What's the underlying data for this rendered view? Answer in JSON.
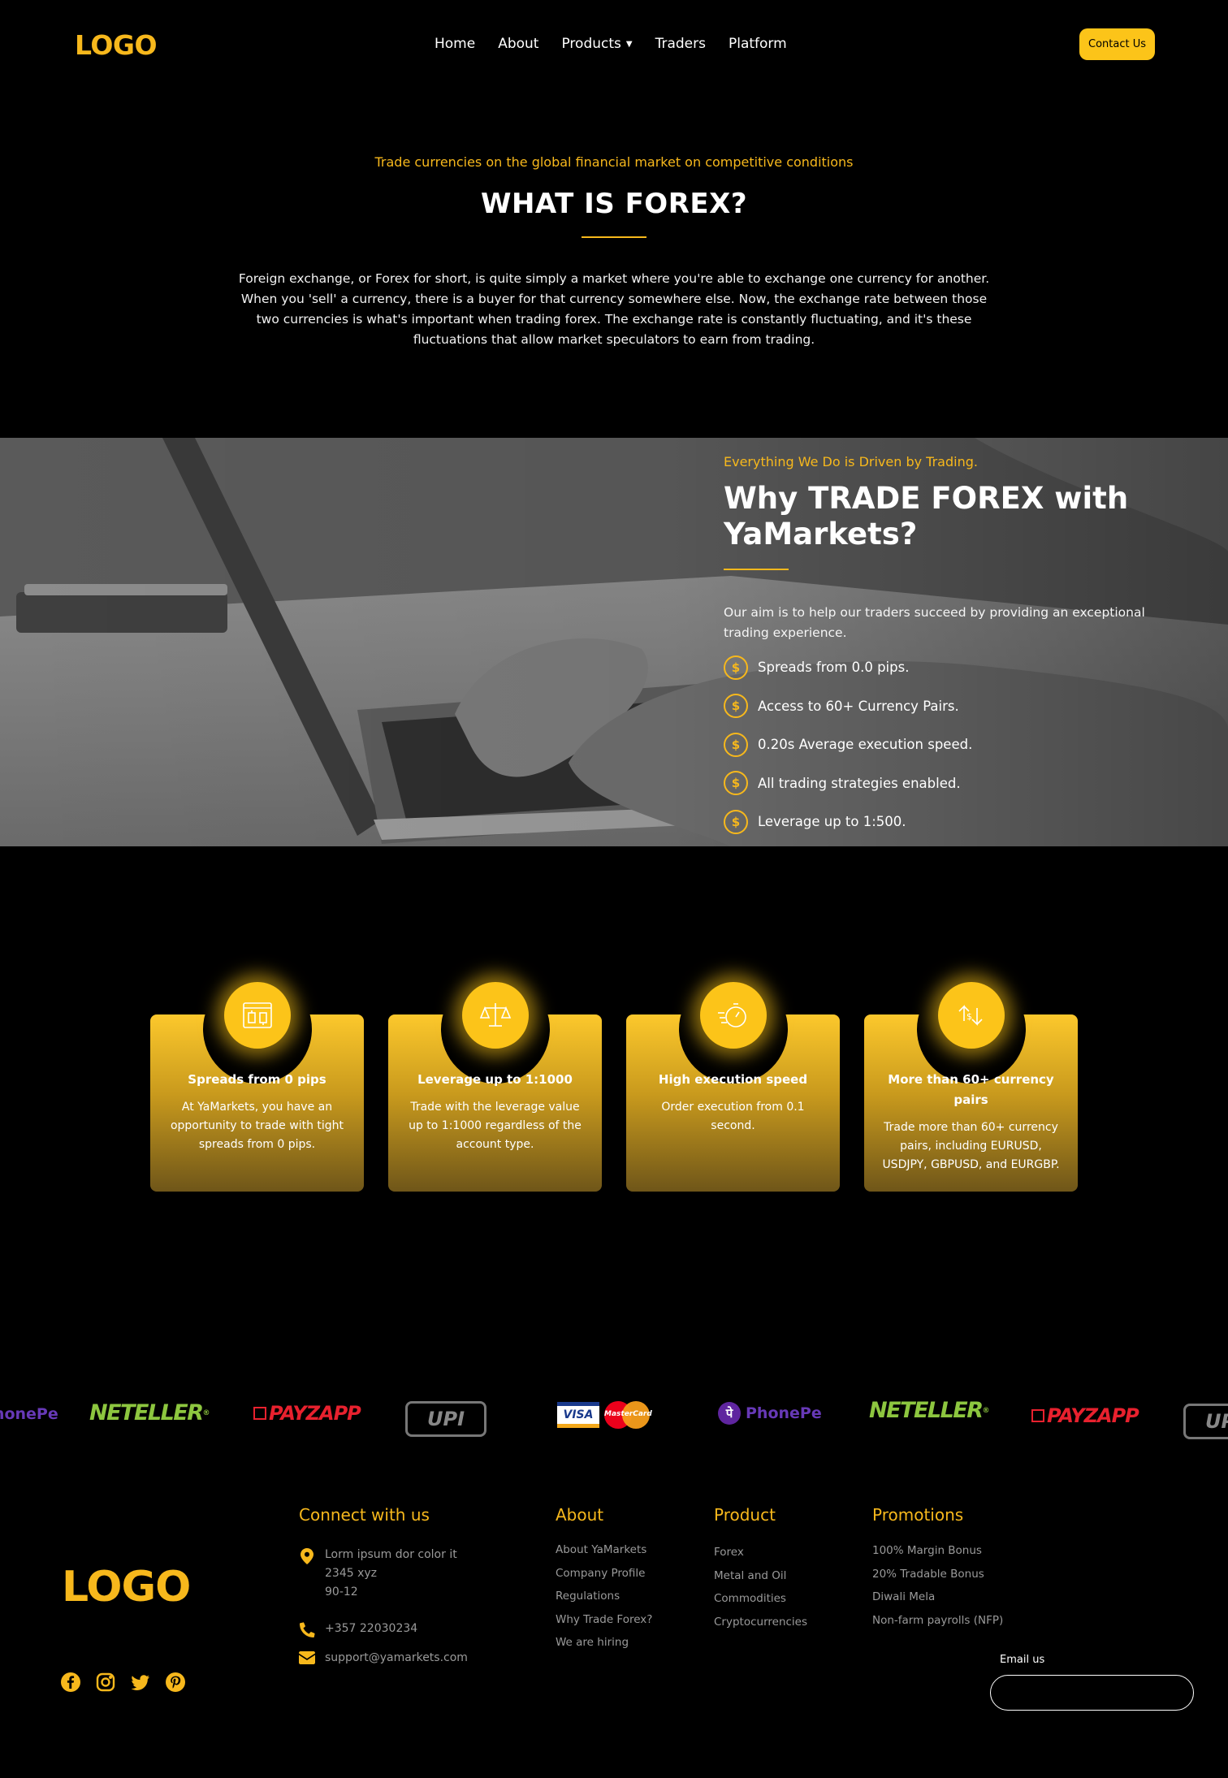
{
  "header": {
    "logo": "LOGO",
    "nav": [
      {
        "label": "Home"
      },
      {
        "label": "About"
      },
      {
        "label": "Products",
        "has_dropdown": true
      },
      {
        "label": "Traders"
      },
      {
        "label": "Platform"
      }
    ],
    "contact_label": "Contact Us"
  },
  "forex": {
    "kicker": "Trade currencies on the global financial market on competitive conditions",
    "title": "WHAT IS FOREX?",
    "description": "Foreign exchange, or Forex for short, is quite simply a market where you're able to exchange one currency for another. When you 'sell' a currency, there is a buyer for that currency somewhere else. Now, the exchange rate between those two currencies is what's important when trading forex. The exchange rate is constantly fluctuating, and it's these fluctuations that allow market speculators to earn from trading."
  },
  "why": {
    "kicker": "Everything We Do is Driven by Trading.",
    "title": "Why TRADE FOREX with YaMarkets?",
    "description": "Our aim is to help our traders succeed by providing an exceptional trading experience.",
    "points": [
      "Spreads from 0.0 pips.",
      "Access to 60+ Currency Pairs.",
      "0.20s Average execution speed.",
      "All trading strategies enabled.",
      "Leverage up to 1:500."
    ],
    "bullet_icon": "dollar-icon"
  },
  "features": [
    {
      "icon": "spread-chart-icon",
      "title": "Spreads from 0 pips",
      "text": "At YaMarkets, you have an opportunity to trade with tight spreads from 0 pips."
    },
    {
      "icon": "scale-icon",
      "title": "Leverage up to 1:1000",
      "text": "Trade with the leverage value up to 1:1000 regardless of the account type."
    },
    {
      "icon": "stopwatch-icon",
      "title": "High execution speed",
      "text": "Order execution from 0.1 second."
    },
    {
      "icon": "currency-exchange-icon",
      "title": "More than 60+ currency pairs",
      "text": "Trade more than 60+ currency pairs, including EURUSD, USDJPY, GBPUSD, and EURGBP."
    }
  ],
  "payments": {
    "items": [
      "PhonePe",
      "NETELLER",
      "PAYZAPP",
      "UPI",
      "VISA",
      "MasterCard",
      "PhonePe",
      "NETELLER",
      "PAYZAPP",
      "UPI"
    ]
  },
  "footer": {
    "logo": "LOGO",
    "socials": [
      "facebook-icon",
      "instagram-icon",
      "twitter-icon",
      "pinterest-icon"
    ],
    "connect": {
      "heading": "Connect with us",
      "address": [
        "Lorm ipsum dor color it",
        "2345 xyz",
        "90-12"
      ],
      "phone": "+357 22030234",
      "email": "support@yamarkets.com"
    },
    "about": {
      "heading": "About",
      "links": [
        "About YaMarkets",
        "Company Profile",
        "Regulations",
        "Why Trade Forex?",
        "We are hiring"
      ]
    },
    "product": {
      "heading": "Product",
      "links": [
        "Forex",
        "Metal and Oil",
        "Commodities",
        "Cryptocurrencies"
      ]
    },
    "promotions": {
      "heading": "Promotions",
      "links": [
        "100% Margin Bonus",
        "20% Tradable Bonus",
        "Diwali Mela",
        "Non-farm payrolls (NFP)"
      ]
    },
    "email_label": "Email us",
    "email_value": ""
  },
  "colors": {
    "accent": "#f7b81c",
    "button": "#fcc419",
    "background": "#000000"
  }
}
